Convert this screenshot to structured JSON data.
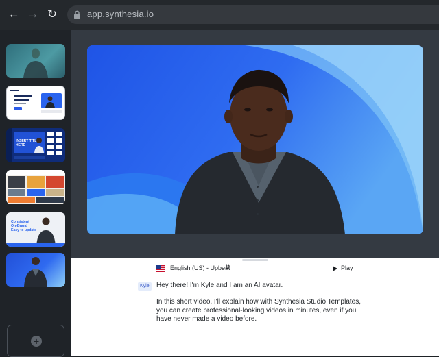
{
  "browser": {
    "url": "app.synthesia.io",
    "back_icon": "arrow-left-icon",
    "forward_icon": "arrow-right-icon",
    "reload_icon": "reload-icon",
    "lock_icon": "lock-icon"
  },
  "sidebar": {
    "slides": [
      {
        "label": "",
        "kind": "avatar-teal"
      },
      {
        "label": "",
        "kind": "template-screen"
      },
      {
        "label": "INSERT TITLE HERE",
        "kind": "studio-editor"
      },
      {
        "label": "",
        "kind": "news-grid"
      },
      {
        "label": "Consistent On-Brand Easy to update",
        "kind": "title-avatar"
      },
      {
        "label": "",
        "kind": "avatar-blue"
      }
    ],
    "add_slide_icon": "plus-icon"
  },
  "preview": {
    "background": "#2a64ee",
    "accent": "#8fd0f7"
  },
  "editor": {
    "language": "English (US) - Upbeat",
    "flag_icon": "us-flag-icon",
    "play_label": "Play",
    "speaker": "Kyle",
    "script": [
      "Hey there! I'm Kyle and I am an AI avatar.",
      "In this short video, I'll explain how with Synthesia Studio Templates, you can create professional-looking videos in minutes, even if you have never made a video before."
    ]
  }
}
